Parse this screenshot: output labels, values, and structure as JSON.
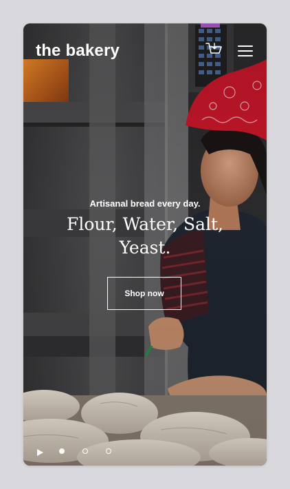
{
  "header": {
    "logo": "the bakery",
    "cart_icon": "cart-icon",
    "menu_icon": "hamburger-menu-icon"
  },
  "hero": {
    "tagline": "Artisanal bread every day.",
    "headline": "Flour, Water, Salt, Yeast.",
    "cta_label": "Shop now"
  },
  "slider": {
    "play_icon": "play-icon",
    "slides": 3,
    "active_index": 0
  },
  "colors": {
    "text": "#ffffff",
    "page_background": "#d9d8dc",
    "bandana": "#c8172a"
  }
}
